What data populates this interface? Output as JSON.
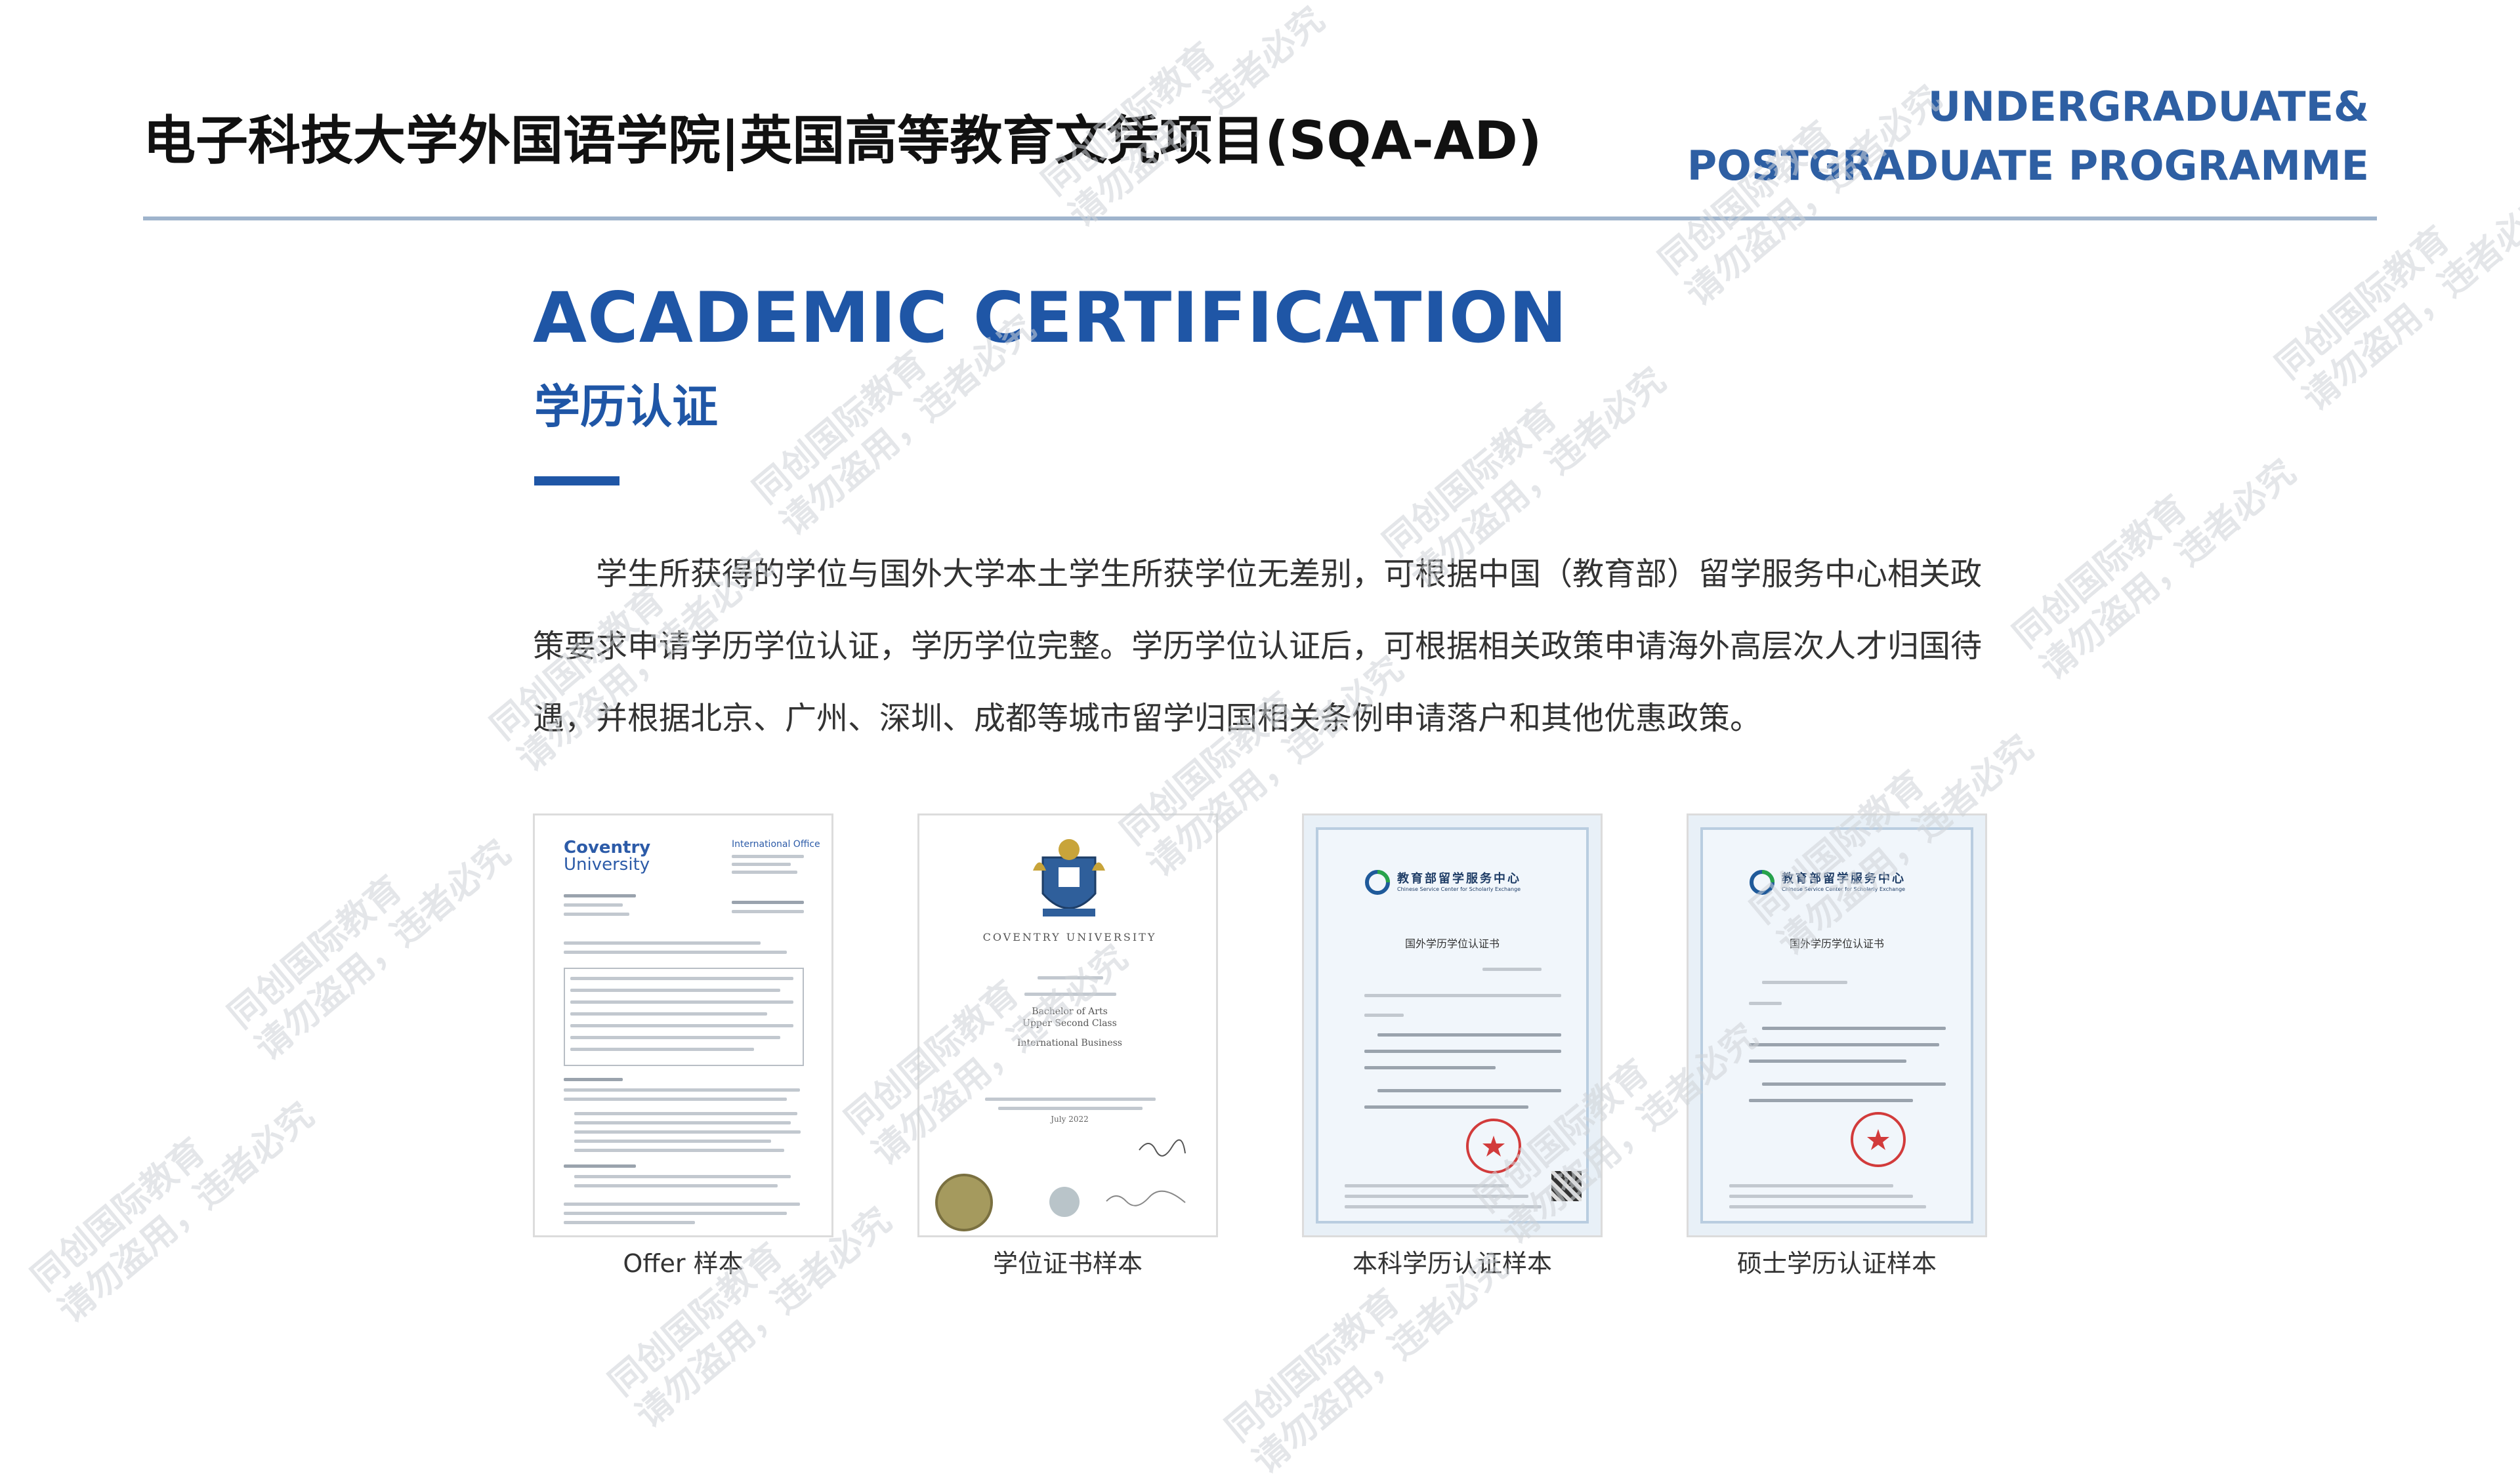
{
  "header": {
    "title": "电子科技大学外国语学院|英国高等教育文凭项目(SQA-AD)",
    "programme_line1": "UNDERGRADUATE&",
    "programme_line2": "POSTGRADUATE PROGRAMME"
  },
  "section": {
    "title_en": "ACADEMIC CERTIFICATION",
    "title_cn": "学历认证"
  },
  "paragraph": "学生所获得的学位与国外大学本土学生所获学位无差别，可根据中国（教育部）留学服务中心相关政策要求申请学历学位认证，学历学位完整。学历学位认证后，可根据相关政策申请海外高层次人才归国待遇，并根据北京、广州、深圳、成都等城市留学归国相关条例申请落户和其他优惠政策。",
  "documents": [
    {
      "caption": "Offer 样本",
      "logo_line1": "Coventry",
      "logo_line2": "University",
      "office_label": "International Office"
    },
    {
      "caption": "学位证书样本",
      "university_name": "COVENTRY UNIVERSITY",
      "degree_line1": "Bachelor of Arts",
      "degree_line2": "Upper Second Class",
      "degree_line3": "International Business",
      "date_line": "July 2022"
    },
    {
      "caption": "本科学历认证样本",
      "org_name": "教育部留学服务中心",
      "org_name_en": "Chinese Service Center for Scholarly Exchange",
      "cert_title": "国外学历学位认证书"
    },
    {
      "caption": "硕士学历认证样本",
      "org_name": "教育部留学服务中心",
      "org_name_en": "Chinese Service Center for Scholarly Exchange",
      "cert_title": "国外学历学位认证书"
    }
  ],
  "watermark": {
    "line1": "同创国际教育",
    "line2": "请勿盗用，违者必究"
  },
  "colors": {
    "accent_blue": "#1f56a6",
    "programme_blue": "#2e5fa3",
    "rule_gray": "#9fb4cc",
    "seal_red": "#d23b3b"
  }
}
